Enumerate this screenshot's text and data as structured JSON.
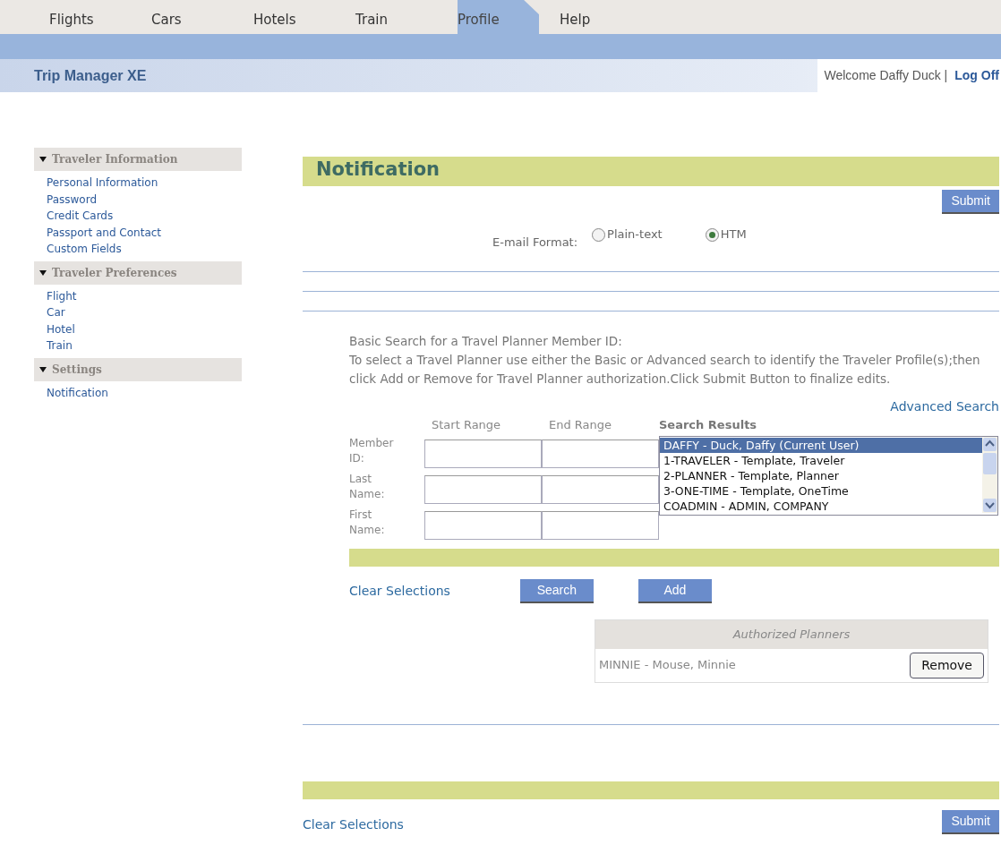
{
  "nav_tabs": [
    {
      "label": "Flights",
      "selected": false
    },
    {
      "label": "Cars",
      "selected": false
    },
    {
      "label": "Hotels",
      "selected": false
    },
    {
      "label": "Train",
      "selected": false
    },
    {
      "label": "Profile",
      "selected": true
    },
    {
      "label": "Help",
      "selected": false
    }
  ],
  "app_title": "Trip Manager XE",
  "welcome": "Welcome Daffy Duck |",
  "log_off": "Log Off",
  "sidebar": [
    {
      "title": "Traveler Information",
      "expanded": true,
      "items": [
        "Personal Information",
        "Password",
        "Credit Cards",
        "Passport and Contact",
        "Custom Fields"
      ]
    },
    {
      "title": "Traveler Preferences",
      "expanded": true,
      "items": [
        "Flight",
        "Car",
        "Hotel",
        "Train"
      ]
    },
    {
      "title": "Settings",
      "expanded": true,
      "items": [
        "Notification"
      ]
    }
  ],
  "page_title": "Notification",
  "submit_top": "Submit",
  "email_format": {
    "label": "E-mail Format:",
    "options": [
      {
        "label": "Plain-text",
        "selected": false
      },
      {
        "label": "HTM",
        "selected": true
      }
    ]
  },
  "search_heading": "Basic Search for a Travel Planner Member ID:",
  "instructions": "To select a Travel Planner use either the Basic or Advanced search to identify the Traveler Profile(s);then click Add or Remove for Travel Planner authorization.Click Submit Button to finalize edits.",
  "advanced_search": "Advanced Search",
  "columns": [
    "Start Range",
    "End Range",
    "Search Results"
  ],
  "rows": [
    "Member ID:",
    "Last Name:",
    "First Name:"
  ],
  "results": [
    {
      "label": "DAFFY - Duck, Daffy (Current User)",
      "selected": true
    },
    {
      "label": "1-TRAVELER - Template, Traveler",
      "selected": false
    },
    {
      "label": "2-PLANNER - Template, Planner",
      "selected": false
    },
    {
      "label": "3-ONE-TIME - Template, OneTime",
      "selected": false
    },
    {
      "label": "COADMIN - ADMIN, COMPANY",
      "selected": false
    }
  ],
  "clear_selections": "Clear Selections",
  "search_button": "Search",
  "add_button": "Add",
  "authorized": {
    "title": "Authorized Planners",
    "planners": [
      {
        "name": "MINNIE - Mouse, Minnie",
        "button": "Remove"
      }
    ]
  },
  "clear_selections_bottom": "Clear Selections",
  "submit_bottom": "Submit"
}
